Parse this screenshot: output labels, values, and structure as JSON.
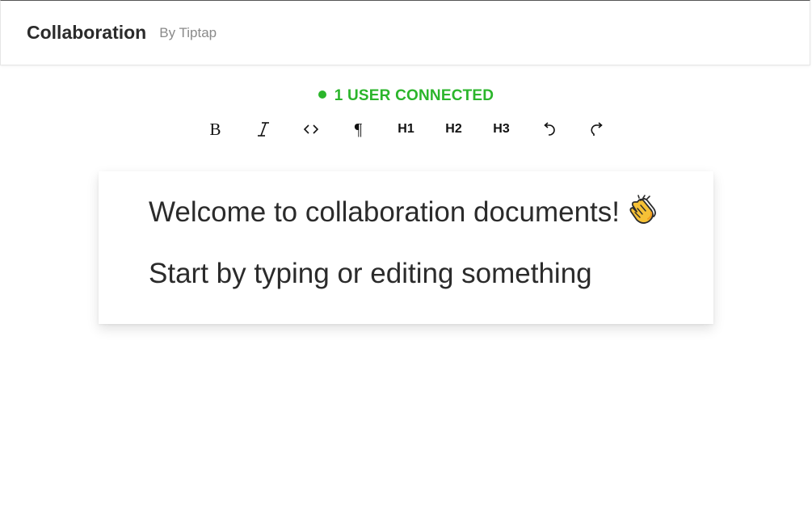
{
  "header": {
    "title": "Collaboration",
    "subtitle": "By Tiptap"
  },
  "status": {
    "text": "1 USER CONNECTED",
    "color": "#2bb52b"
  },
  "toolbar": {
    "items": [
      {
        "id": "bold",
        "icon": "bold-icon",
        "label": "B"
      },
      {
        "id": "italic",
        "icon": "italic-icon",
        "label": ""
      },
      {
        "id": "code",
        "icon": "code-icon",
        "label": ""
      },
      {
        "id": "paragraph",
        "icon": "paragraph-icon",
        "label": "¶"
      },
      {
        "id": "h1",
        "icon": "",
        "label": "H1"
      },
      {
        "id": "h2",
        "icon": "",
        "label": "H2"
      },
      {
        "id": "h3",
        "icon": "",
        "label": "H3"
      },
      {
        "id": "undo",
        "icon": "undo-icon",
        "label": ""
      },
      {
        "id": "redo",
        "icon": "redo-icon",
        "label": ""
      }
    ]
  },
  "editor": {
    "line1": "Welcome to collaboration documents!",
    "line1_emoji": "clapping-hands-icon",
    "line2": "Start by typing or editing something"
  }
}
